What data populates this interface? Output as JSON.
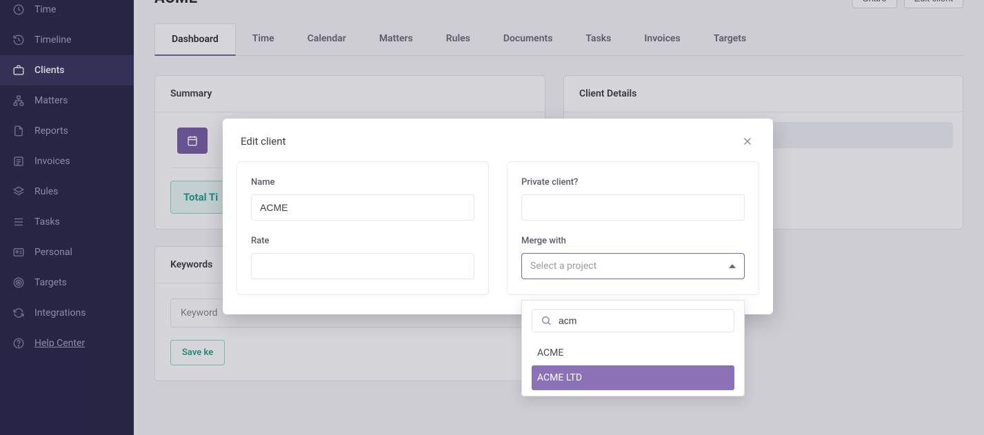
{
  "sidebar": {
    "items": [
      {
        "label": "Time"
      },
      {
        "label": "Timeline"
      },
      {
        "label": "Clients"
      },
      {
        "label": "Matters"
      },
      {
        "label": "Reports"
      },
      {
        "label": "Invoices"
      },
      {
        "label": "Rules"
      },
      {
        "label": "Tasks"
      },
      {
        "label": "Personal"
      },
      {
        "label": "Targets"
      },
      {
        "label": "Integrations"
      },
      {
        "label": "Help Center"
      }
    ]
  },
  "header": {
    "title": "ACME",
    "share": "Share",
    "edit": "Edit client"
  },
  "tabs": [
    "Dashboard",
    "Time",
    "Calendar",
    "Matters",
    "Rules",
    "Documents",
    "Tasks",
    "Invoices",
    "Targets"
  ],
  "summary": {
    "title": "Summary",
    "total_label": "Total Ti"
  },
  "details": {
    "title": "Client Details"
  },
  "keywords": {
    "title": "Keywords",
    "input_value": "Keyword",
    "save": "Save ke"
  },
  "modal": {
    "title": "Edit client",
    "name_label": "Name",
    "name_value": "ACME",
    "rate_label": "Rate",
    "rate_value": "",
    "private_label": "Private client?",
    "private_value": "",
    "merge_label": "Merge with",
    "merge_placeholder": "Select a project",
    "search_value": "acm",
    "options": [
      "ACME",
      "ACME LTD"
    ]
  }
}
